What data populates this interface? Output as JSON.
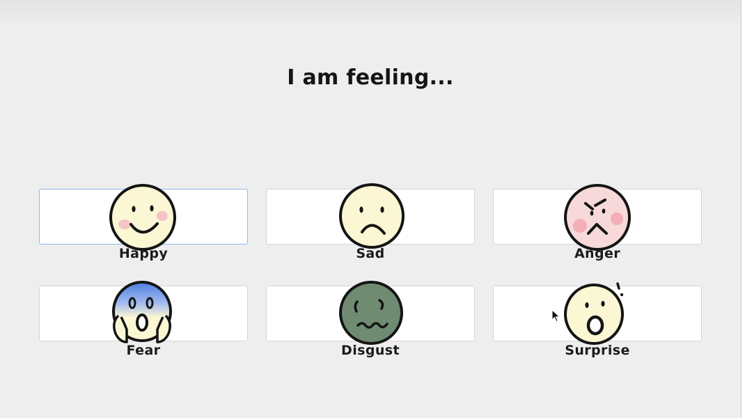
{
  "heading": "I am feeling...",
  "emotions": [
    {
      "label": "Happy",
      "icon": "happy-face-icon",
      "face_color": "#fbf6d3",
      "selected": true
    },
    {
      "label": "Sad",
      "icon": "sad-face-icon",
      "face_color": "#fbf6d3",
      "selected": false
    },
    {
      "label": "Anger",
      "icon": "angry-face-icon",
      "face_color": "#f7d9d9",
      "selected": false
    },
    {
      "label": "Fear",
      "icon": "fear-face-icon",
      "face_color": "#fbf6d3",
      "selected": false
    },
    {
      "label": "Disgust",
      "icon": "disgust-face-icon",
      "face_color": "#6f8b72",
      "selected": false
    },
    {
      "label": "Surprise",
      "icon": "surprise-face-icon",
      "face_color": "#fbf6d3",
      "selected": false
    }
  ],
  "colors": {
    "selected_border": "#8fb6e8",
    "fear_tint": "#4f7fe0",
    "blush": "#f4b8c2"
  }
}
